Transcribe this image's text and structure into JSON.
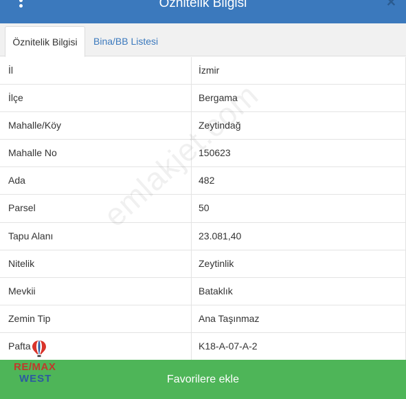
{
  "header": {
    "title": "Öznitelik Bilgisi",
    "menu_icon": "vertical-dots-icon",
    "close_icon": "close-icon"
  },
  "tabs": [
    {
      "label": "Öznitelik Bilgisi",
      "active": true
    },
    {
      "label": "Bina/BB Listesi",
      "active": false
    }
  ],
  "rows": [
    {
      "key": "İl",
      "value": "İzmir"
    },
    {
      "key": "İlçe",
      "value": "Bergama"
    },
    {
      "key": "Mahalle/Köy",
      "value": "Zeytindağ"
    },
    {
      "key": "Mahalle No",
      "value": "150623"
    },
    {
      "key": "Ada",
      "value": "482"
    },
    {
      "key": "Parsel",
      "value": "50"
    },
    {
      "key": "Tapu Alanı",
      "value": "23.081,40"
    },
    {
      "key": "Nitelik",
      "value": "Zeytinlik"
    },
    {
      "key": "Mevkii",
      "value": "Bataklık"
    },
    {
      "key": "Zemin Tip",
      "value": "Ana Taşınmaz"
    },
    {
      "key": "Pafta",
      "value": "K18-A-07-A-2"
    }
  ],
  "footer": {
    "button_label": "Favorilere ekle"
  },
  "watermark": "emlakjet.com",
  "logo": {
    "line1": "RE/MAX",
    "line2": "WEST"
  },
  "colors": {
    "header": "#3b79bd",
    "tab_link": "#3b79bd",
    "footer_button": "#4eb558"
  }
}
